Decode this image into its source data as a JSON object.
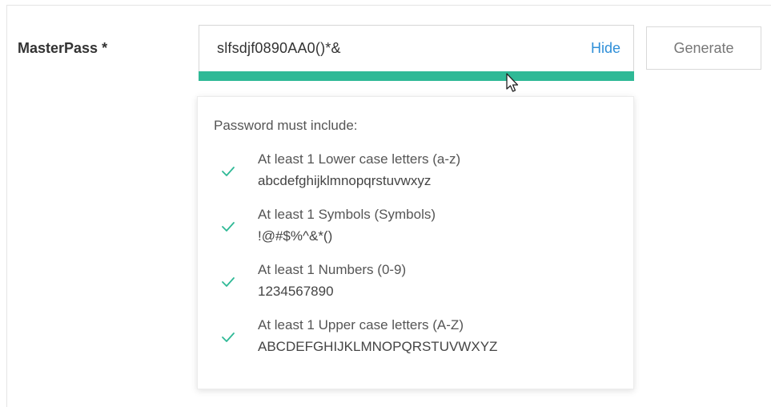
{
  "form": {
    "field_label": "MasterPass *",
    "password_value": "slfsdjf0890AA0()*&",
    "hide_label": "Hide",
    "generate_label": "Generate",
    "strength_color": "#2fb996",
    "strength_fraction": 1.0
  },
  "requirements": {
    "title": "Password must include:",
    "check_color": "#2fb996",
    "items": [
      {
        "label": "At least 1 Lower case letters (a-z)",
        "chars": "abcdefghijklmnopqrstuvwxyz",
        "met": true
      },
      {
        "label": "At least 1 Symbols (Symbols)",
        "chars": "!@#$%^&*()",
        "met": true
      },
      {
        "label": "At least 1 Numbers (0-9)",
        "chars": "1234567890",
        "met": true
      },
      {
        "label": "At least 1 Upper case letters (A-Z)",
        "chars": "ABCDEFGHIJKLMNOPQRSTUVWXYZ",
        "met": true
      }
    ]
  }
}
